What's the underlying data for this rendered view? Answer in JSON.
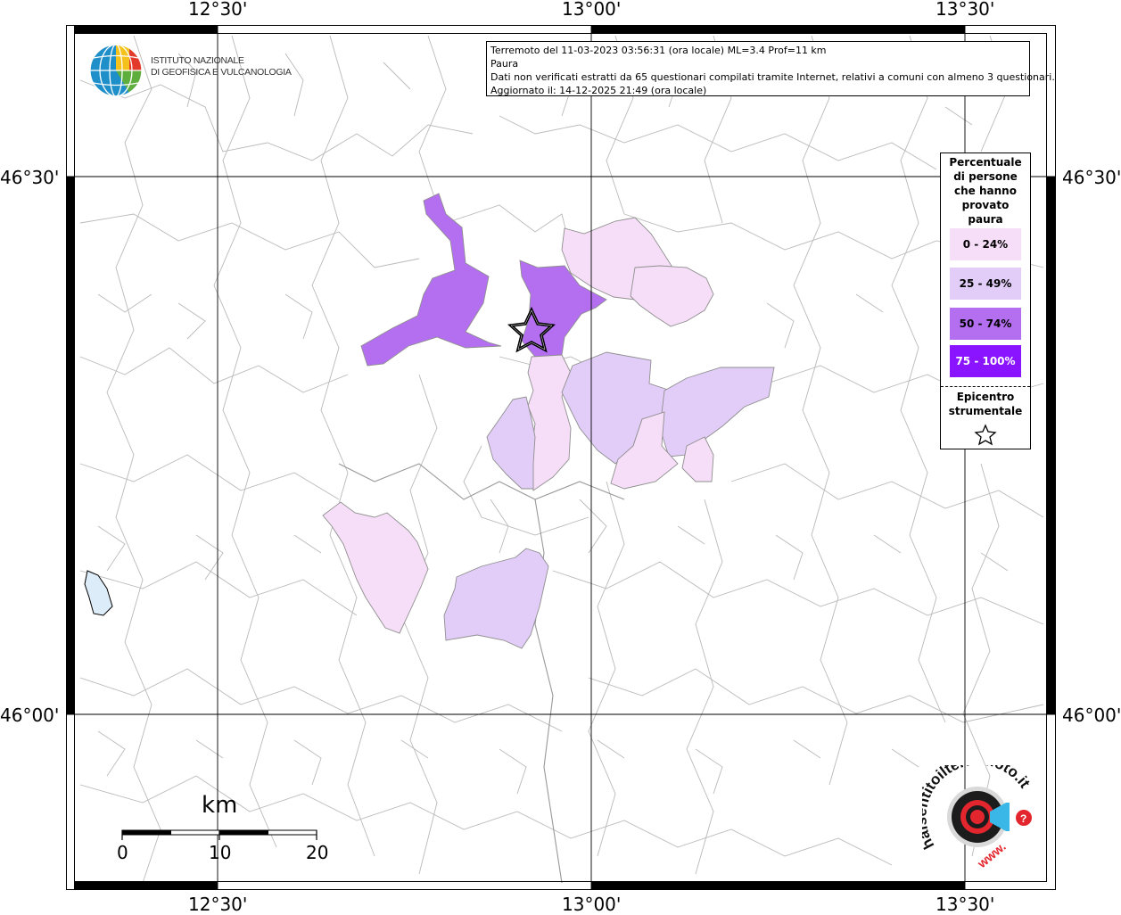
{
  "map": {
    "top_ticks": [
      "12°30'",
      "13°00'",
      "13°30'"
    ],
    "bottom_ticks": [
      "12°30'",
      "13°00'",
      "13°30'"
    ],
    "left_ticks": [
      "46°30'",
      "46°00'"
    ],
    "right_ticks": [
      "46°30'",
      "46°00'"
    ]
  },
  "logo": {
    "line1": "ISTITUTO NAZIONALE",
    "line2": "DI GEOFISICA E VULCANOLOGIA"
  },
  "info": {
    "line1": "Terremoto del 11-03-2023 03:56:31 (ora locale) ML=3.4 Prof=11 km",
    "line2": "Paura",
    "line3": "Dati non verificati estratti da 65 questionari compilati tramite Internet, relativi a comuni con almeno 3 questionari.",
    "line4": "Aggiornato il: 14-12-2025 21:49 (ora locale)"
  },
  "legend": {
    "title": [
      "Percentuale",
      "di persone",
      "che hanno",
      "provato",
      "paura"
    ],
    "classes": [
      {
        "label": "0 - 24%",
        "color": "#f7def8"
      },
      {
        "label": "25 - 49%",
        "color": "#e2cdf8"
      },
      {
        "label": "50 - 74%",
        "color": "#b36ff0"
      },
      {
        "label": "75 - 100%",
        "color": "#8a14ff",
        "text_color": "#ffffff"
      }
    ],
    "epicenter": [
      "Epicentro",
      "strumentale"
    ]
  },
  "scale": {
    "unit": "km",
    "labels": [
      "0",
      "10",
      "20"
    ]
  },
  "badge": {
    "text_top": "haisentitoilterremoto.it",
    "text_bottom": "www."
  }
}
